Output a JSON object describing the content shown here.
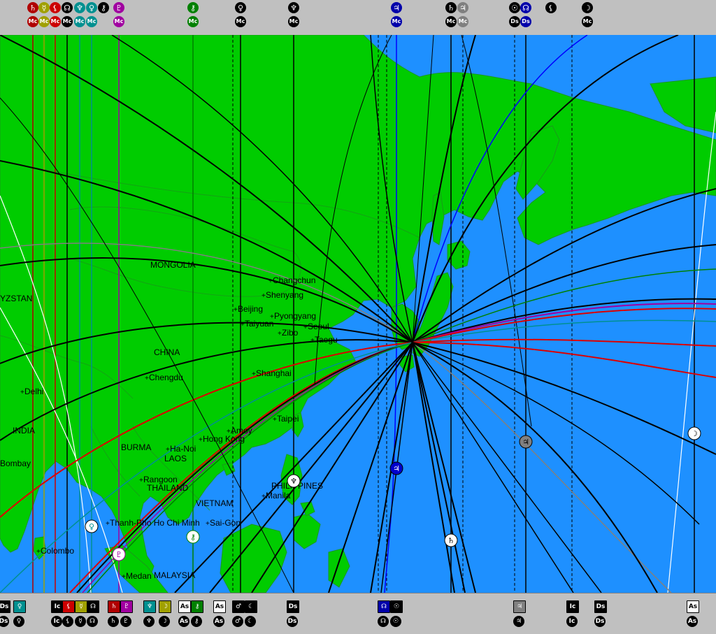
{
  "map": {
    "ocean_color": "#1e90ff",
    "land_color": "#00cc00",
    "border_color": "#1a9a1a",
    "country_labels": [
      {
        "id": "mongolia",
        "name": "MONGOLIA"
      },
      {
        "id": "china",
        "name": "CHINA"
      },
      {
        "id": "india",
        "name": "INDIA"
      },
      {
        "id": "burma",
        "name": "BURMA"
      },
      {
        "id": "laos",
        "name": "LAOS"
      },
      {
        "id": "thailand",
        "name": "THAILAND"
      },
      {
        "id": "vietnam",
        "name": "VIETNAM"
      },
      {
        "id": "philippines",
        "name": "PHILIPPINES"
      },
      {
        "id": "malaysia",
        "name": "MALAYSIA"
      },
      {
        "id": "kyrgyzstan",
        "name": "YZSTAN"
      }
    ],
    "cities": [
      {
        "id": "changchun",
        "name": "Changchun"
      },
      {
        "id": "shenyang",
        "name": "Shenyang"
      },
      {
        "id": "beijing",
        "name": "Beijing"
      },
      {
        "id": "pyongyang",
        "name": "Pyongyang"
      },
      {
        "id": "taiyuan",
        "name": "Taiyuan"
      },
      {
        "id": "seoul",
        "name": "Seoul"
      },
      {
        "id": "zibo",
        "name": "Zibo"
      },
      {
        "id": "taegu",
        "name": "Taegu"
      },
      {
        "id": "chengdu",
        "name": "Chengdu"
      },
      {
        "id": "shanghai",
        "name": "Shanghai"
      },
      {
        "id": "delhi",
        "name": "Delhi"
      },
      {
        "id": "bombay",
        "name": "Bombay"
      },
      {
        "id": "taipei",
        "name": "Taipei"
      },
      {
        "id": "hongkong",
        "name": "Hong Kong"
      },
      {
        "id": "xiamen",
        "name": "Amoy"
      },
      {
        "id": "hanoi",
        "name": "Ha-Noi"
      },
      {
        "id": "rangoon",
        "name": "Rangoon"
      },
      {
        "id": "thanhpho",
        "name": "Thanh-Pho Ho Chi Minh"
      },
      {
        "id": "saigon",
        "name": "Sai-Gon"
      },
      {
        "id": "manila",
        "name": "Manila"
      },
      {
        "id": "colombo",
        "name": "Colombo"
      },
      {
        "id": "medan",
        "name": "Medan"
      }
    ]
  },
  "planet_colors": {
    "saturn": "#b00000",
    "mercury": "#a0a000",
    "lilith": "#cc0000",
    "uranus": "#009090",
    "venus": "#009090",
    "jupiter_node": "#000000",
    "pluto": "#a000a0",
    "chiron": "#008000",
    "sun": "#000000",
    "neptune": "#000000",
    "moon_node": "#0000aa",
    "mars": "#000000",
    "jupiter": "#808080",
    "asc": "#000000",
    "ic": "#000000"
  },
  "top_bar": {
    "glyphs": [
      {
        "id": "top-saturn-mc",
        "symbol": "♄",
        "label": "Mc",
        "color": "#b00000"
      },
      {
        "id": "top-mercury-mc",
        "symbol": "☿",
        "label": "Mc",
        "color": "#a0a000"
      },
      {
        "id": "top-lilith-mc",
        "symbol": "⚸",
        "label": "Mc",
        "color": "#cc0000"
      },
      {
        "id": "top-node-mc",
        "symbol": "☊",
        "label": "Mc",
        "color": "#000000"
      },
      {
        "id": "top-neptune-mc",
        "symbol": "♆",
        "label": "Mc",
        "color": "#009090"
      },
      {
        "id": "top-venus-mc",
        "symbol": "♀",
        "label": "Mc",
        "color": "#009090"
      },
      {
        "id": "top-vertex",
        "symbol": "⚷",
        "label": "",
        "color": "#000000"
      },
      {
        "id": "top-pluto-mc",
        "symbol": "♇",
        "label": "Mc",
        "color": "#a000a0"
      },
      {
        "id": "top-chiron-mc",
        "symbol": "⚷",
        "label": "Mc",
        "color": "#008000"
      },
      {
        "id": "top-venus2-mc",
        "symbol": "♀",
        "label": "Mc",
        "color": "#000000"
      },
      {
        "id": "top-neptune2-mc",
        "symbol": "♆",
        "label": "Mc",
        "color": "#000000"
      },
      {
        "id": "top-moonnode-mc",
        "symbol": "♃",
        "label": "Mc",
        "color": "#0000aa"
      },
      {
        "id": "top-saturn2-mc",
        "symbol": "♄",
        "label": "Mc",
        "color": "#000000"
      },
      {
        "id": "top-jupiter-mc",
        "symbol": "♃",
        "label": "Mc",
        "color": "#808080"
      },
      {
        "id": "top-sun-ds",
        "symbol": "☉",
        "label": "Ds",
        "color": "#000000"
      },
      {
        "id": "top-node-ds",
        "symbol": "☊",
        "label": "Ds",
        "color": "#0000aa"
      },
      {
        "id": "top-lilith-ds",
        "symbol": "⚸",
        "label": "",
        "color": "#000000"
      },
      {
        "id": "top-moon-mc",
        "symbol": "☽",
        "label": "Mc",
        "color": "#000000"
      }
    ]
  },
  "bottom_bar": {
    "glyphs": [
      {
        "id": "bot-ds",
        "symbol": "Ds",
        "color": "#000000"
      },
      {
        "id": "bot-venus",
        "symbol": "♀",
        "color": "#009090"
      },
      {
        "id": "bot-ic",
        "symbol": "Ic",
        "color": "#000000"
      },
      {
        "id": "bot-lilith",
        "symbol": "⚸",
        "color": "#cc0000"
      },
      {
        "id": "bot-mercury",
        "symbol": "☿",
        "color": "#a0a000"
      },
      {
        "id": "bot-node",
        "symbol": "☊",
        "color": "#000000"
      },
      {
        "id": "bot-saturn",
        "symbol": "♄",
        "color": "#b00000"
      },
      {
        "id": "bot-pluto",
        "symbol": "♇",
        "color": "#a000a0"
      },
      {
        "id": "bot-neptune",
        "symbol": "♆",
        "color": "#009090"
      },
      {
        "id": "bot-moon",
        "symbol": "☽",
        "color": "#a0a000"
      },
      {
        "id": "bot-asc",
        "symbol": "As",
        "color": "#ffffff"
      },
      {
        "id": "bot-chiron",
        "symbol": "⚷",
        "color": "#008000"
      },
      {
        "id": "bot-asc2",
        "symbol": "As",
        "color": "#ffffff"
      },
      {
        "id": "bot-mars",
        "symbol": "♂",
        "color": "#000000"
      },
      {
        "id": "bot-moon2",
        "symbol": "☾",
        "color": "#000000"
      },
      {
        "id": "bot-ds2",
        "symbol": "Ds",
        "color": "#000000"
      },
      {
        "id": "bot-node2",
        "symbol": "☊",
        "color": "#0000aa"
      },
      {
        "id": "bot-sun",
        "symbol": "☉",
        "color": "#000000"
      },
      {
        "id": "bot-jupiter",
        "symbol": "♃",
        "color": "#808080"
      },
      {
        "id": "bot-ic2",
        "symbol": "Ic",
        "color": "#000000"
      },
      {
        "id": "bot-ds3",
        "symbol": "Ds",
        "color": "#000000"
      },
      {
        "id": "bot-asc3",
        "symbol": "As",
        "color": "#ffffff"
      }
    ]
  }
}
